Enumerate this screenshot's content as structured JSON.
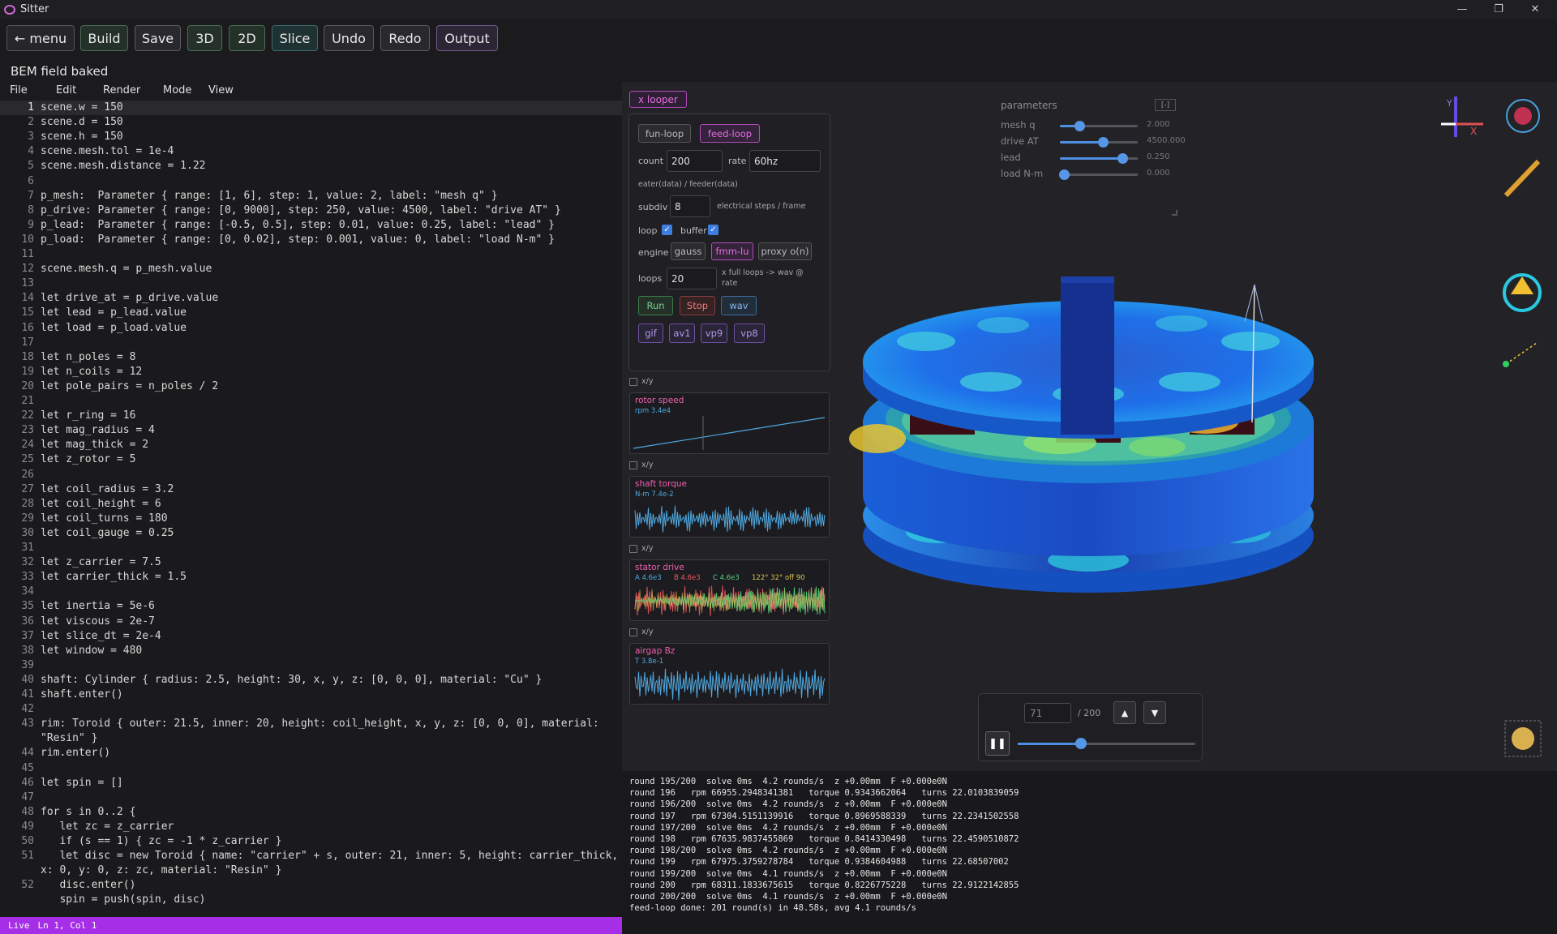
{
  "window": {
    "title": "Sitter",
    "min": "—",
    "restore": "❐",
    "close": "✕"
  },
  "toolbar": {
    "menu": "← menu",
    "build": "Build",
    "save": "Save",
    "three_d": "3D",
    "two_d": "2D",
    "slice": "Slice",
    "undo": "Undo",
    "redo": "Redo",
    "output": "Output"
  },
  "status_text": "BEM field baked",
  "menu": {
    "file": "File",
    "edit": "Edit",
    "render": "Render",
    "mode": "Mode",
    "view": "View"
  },
  "editor": {
    "lines": [
      {
        "n": "1",
        "t": "scene.w = 150"
      },
      {
        "n": "2",
        "t": "scene.d = 150"
      },
      {
        "n": "3",
        "t": "scene.h = 150"
      },
      {
        "n": "4",
        "t": "scene.mesh.tol = 1e-4"
      },
      {
        "n": "5",
        "t": "scene.mesh.distance = 1.22"
      },
      {
        "n": "6",
        "t": ""
      },
      {
        "n": "7",
        "t": "p_mesh:  Parameter { range: [1, 6], step: 1, value: 2, label: \"mesh q\" }"
      },
      {
        "n": "8",
        "t": "p_drive: Parameter { range: [0, 9000], step: 250, value: 4500, label: \"drive AT\" }"
      },
      {
        "n": "9",
        "t": "p_lead:  Parameter { range: [-0.5, 0.5], step: 0.01, value: 0.25, label: \"lead\" }"
      },
      {
        "n": "10",
        "t": "p_load:  Parameter { range: [0, 0.02], step: 0.001, value: 0, label: \"load N-m\" }"
      },
      {
        "n": "11",
        "t": ""
      },
      {
        "n": "12",
        "t": "scene.mesh.q = p_mesh.value"
      },
      {
        "n": "13",
        "t": ""
      },
      {
        "n": "14",
        "t": "let drive_at = p_drive.value"
      },
      {
        "n": "15",
        "t": "let lead = p_lead.value"
      },
      {
        "n": "16",
        "t": "let load = p_load.value"
      },
      {
        "n": "17",
        "t": ""
      },
      {
        "n": "18",
        "t": "let n_poles = 8"
      },
      {
        "n": "19",
        "t": "let n_coils = 12"
      },
      {
        "n": "20",
        "t": "let pole_pairs = n_poles / 2"
      },
      {
        "n": "21",
        "t": ""
      },
      {
        "n": "22",
        "t": "let r_ring = 16"
      },
      {
        "n": "23",
        "t": "let mag_radius = 4"
      },
      {
        "n": "24",
        "t": "let mag_thick = 2"
      },
      {
        "n": "25",
        "t": "let z_rotor = 5"
      },
      {
        "n": "26",
        "t": ""
      },
      {
        "n": "27",
        "t": "let coil_radius = 3.2"
      },
      {
        "n": "28",
        "t": "let coil_height = 6"
      },
      {
        "n": "29",
        "t": "let coil_turns = 180"
      },
      {
        "n": "30",
        "t": "let coil_gauge = 0.25"
      },
      {
        "n": "31",
        "t": ""
      },
      {
        "n": "32",
        "t": "let z_carrier = 7.5"
      },
      {
        "n": "33",
        "t": "let carrier_thick = 1.5"
      },
      {
        "n": "34",
        "t": ""
      },
      {
        "n": "35",
        "t": "let inertia = 5e-6"
      },
      {
        "n": "36",
        "t": "let viscous = 2e-7"
      },
      {
        "n": "37",
        "t": "let slice_dt = 2e-4"
      },
      {
        "n": "38",
        "t": "let window = 480"
      },
      {
        "n": "39",
        "t": ""
      },
      {
        "n": "40",
        "t": "shaft: Cylinder { radius: 2.5, height: 30, x, y, z: [0, 0, 0], material: \"Cu\" }"
      },
      {
        "n": "41",
        "t": "shaft.enter()"
      },
      {
        "n": "42",
        "t": ""
      },
      {
        "n": "43",
        "t": "rim: Toroid { outer: 21.5, inner: 20, height: coil_height, x, y, z: [0, 0, 0], material:"
      },
      {
        "n": "",
        "t": "\"Resin\" }"
      },
      {
        "n": "44",
        "t": "rim.enter()"
      },
      {
        "n": "45",
        "t": ""
      },
      {
        "n": "46",
        "t": "let spin = []"
      },
      {
        "n": "47",
        "t": ""
      },
      {
        "n": "48",
        "t": "for s in 0..2 {"
      },
      {
        "n": "49",
        "t": "   let zc = z_carrier"
      },
      {
        "n": "50",
        "t": "   if (s == 1) { zc = -1 * z_carrier }"
      },
      {
        "n": "51",
        "t": "   let disc = new Toroid { name: \"carrier\" + s, outer: 21, inner: 5, height: carrier_thick,"
      },
      {
        "n": "",
        "t": "x: 0, y: 0, z: zc, material: \"Resin\" }"
      },
      {
        "n": "52",
        "t": "   disc.enter()"
      },
      {
        "n": "",
        "t": "   spin = push(spin, disc)"
      }
    ]
  },
  "statusbar": {
    "mode": "Live",
    "position": "Ln 1, Col 1"
  },
  "looper": {
    "chip": "x  looper",
    "fun_loop": "fun-loop",
    "feed_loop": "feed-loop",
    "count_label": "count",
    "count_value": "200",
    "rate_label": "rate",
    "rate_value": "60hz",
    "eater_label": "eater(data) / feeder(data)",
    "subdiv_label": "subdiv",
    "subdiv_value": "8",
    "subdiv_note": "electrical steps / frame",
    "loop_label": "loop",
    "buffer_label": "buffer",
    "engine_label": "engine",
    "engine_gauss": "gauss",
    "engine_fmm": "fmm-lu",
    "engine_proxy": "proxy o(n)",
    "loops_label": "loops",
    "loops_value": "20",
    "loops_note": "x full loops -> wav @ rate",
    "run": "Run",
    "stop": "Stop",
    "wav": "wav",
    "gif": "gif",
    "av1": "av1",
    "vp9": "vp9",
    "vp8": "vp8"
  },
  "graphs": [
    {
      "xy": "x/y",
      "title": "rotor speed",
      "sub": "rpm 3.4e4",
      "sub2": "",
      "sub3": "",
      "sub4": ""
    },
    {
      "xy": "x/y",
      "title": "shaft torque",
      "sub": "N-m 7.4e-2",
      "sub2": "",
      "sub3": "",
      "sub4": ""
    },
    {
      "xy": "x/y",
      "title": "stator drive",
      "sub": "A 4.6e3",
      "sub2": "B 4.6e3",
      "sub3": "C 4.6e3",
      "sub4": "122° 32° off 90"
    },
    {
      "xy": "x/y",
      "title": "airgap Bz",
      "sub": "T 3.8e-1",
      "sub2": "",
      "sub3": "",
      "sub4": ""
    }
  ],
  "parameters": {
    "title": "parameters",
    "collapse": "[-]",
    "rows": [
      {
        "label": "mesh q",
        "value": "2.000",
        "fraction": 0.2
      },
      {
        "label": "drive AT",
        "value": "4500.000",
        "fraction": 0.5
      },
      {
        "label": "lead",
        "value": "0.250",
        "fraction": 0.75
      },
      {
        "label": "load N-m",
        "value": "0.000",
        "fraction": 0.0
      }
    ]
  },
  "playback": {
    "frame": "71",
    "total": "/ 200",
    "progress": 0.355
  },
  "console": [
    "round 195/200  solve 0ms  4.2 rounds/s  z +0.00mm  F +0.000e0N",
    "round 196   rpm 66955.2948341381   torque 0.9343662064   turns 22.0103839059",
    "round 196/200  solve 0ms  4.2 rounds/s  z +0.00mm  F +0.000e0N",
    "round 197   rpm 67304.5151139916   torque 0.8969588339   turns 22.2341502558",
    "round 197/200  solve 0ms  4.2 rounds/s  z +0.00mm  F +0.000e0N",
    "round 198   rpm 67635.9837455869   torque 0.8414330498   turns 22.4590510872",
    "round 198/200  solve 0ms  4.2 rounds/s  z +0.00mm  F +0.000e0N",
    "round 199   rpm 67975.3759278784   torque 0.9384604988   turns 22.68507002",
    "round 199/200  solve 0ms  4.1 rounds/s  z +0.00mm  F +0.000e0N",
    "round 200   rpm 68311.1833675615   torque 0.8226775228   turns 22.9122142855",
    "round 200/200  solve 0ms  4.1 rounds/s  z +0.00mm  F +0.000e0N",
    "feed-loop done: 201 round(s) in 48.58s, avg 4.1 rounds/s"
  ],
  "gizmo": {
    "y": "Y",
    "x": "X"
  },
  "colors": {
    "accent": "#a52ee6",
    "pink": "#e46ee0",
    "blue": "#4d8fe0"
  }
}
